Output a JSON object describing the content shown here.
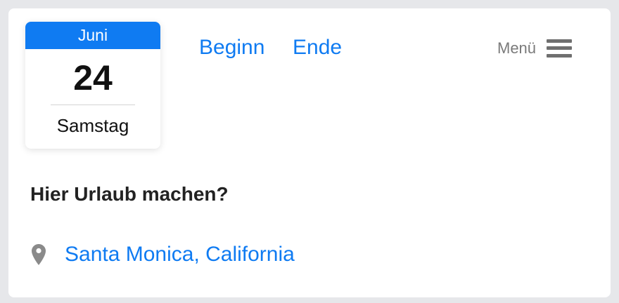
{
  "calendar": {
    "month": "Juni",
    "day": "24",
    "weekday": "Samstag"
  },
  "nav": {
    "begin_label": "Beginn",
    "end_label": "Ende"
  },
  "menu": {
    "label": "Menü",
    "icon": "hamburger-icon"
  },
  "content": {
    "question": "Hier Urlaub machen?",
    "location_icon": "location-pin-icon",
    "location": "Santa Monica, California"
  },
  "colors": {
    "accent": "#0f7bf2",
    "text": "#111111",
    "muted": "#7a7a7a",
    "background": "#e6e7ea",
    "card": "#ffffff"
  }
}
